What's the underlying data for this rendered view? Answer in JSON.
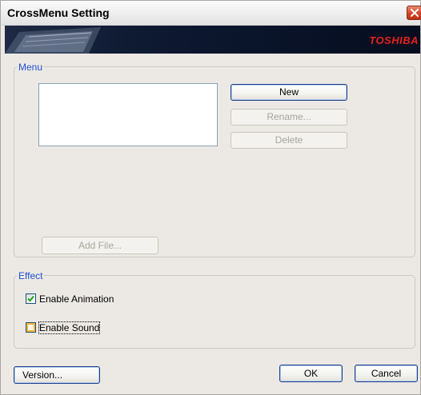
{
  "window": {
    "title": "CrossMenu Setting",
    "brand": "TOSHIBA"
  },
  "menu_group": {
    "legend": "Menu",
    "new_label": "New",
    "rename_label": "Rename...",
    "delete_label": "Delete",
    "add_file_label": "Add File..."
  },
  "effect_group": {
    "legend": "Effect",
    "animation": {
      "label": "Enable Animation",
      "checked": true
    },
    "sound": {
      "label": "Enable Sound",
      "checked": false
    }
  },
  "footer": {
    "version_label": "Version...",
    "ok_label": "OK",
    "cancel_label": "Cancel"
  },
  "colors": {
    "legend_text": "#1f4fd1",
    "brand_red": "#e5231b",
    "close_red": "#d0452a"
  }
}
